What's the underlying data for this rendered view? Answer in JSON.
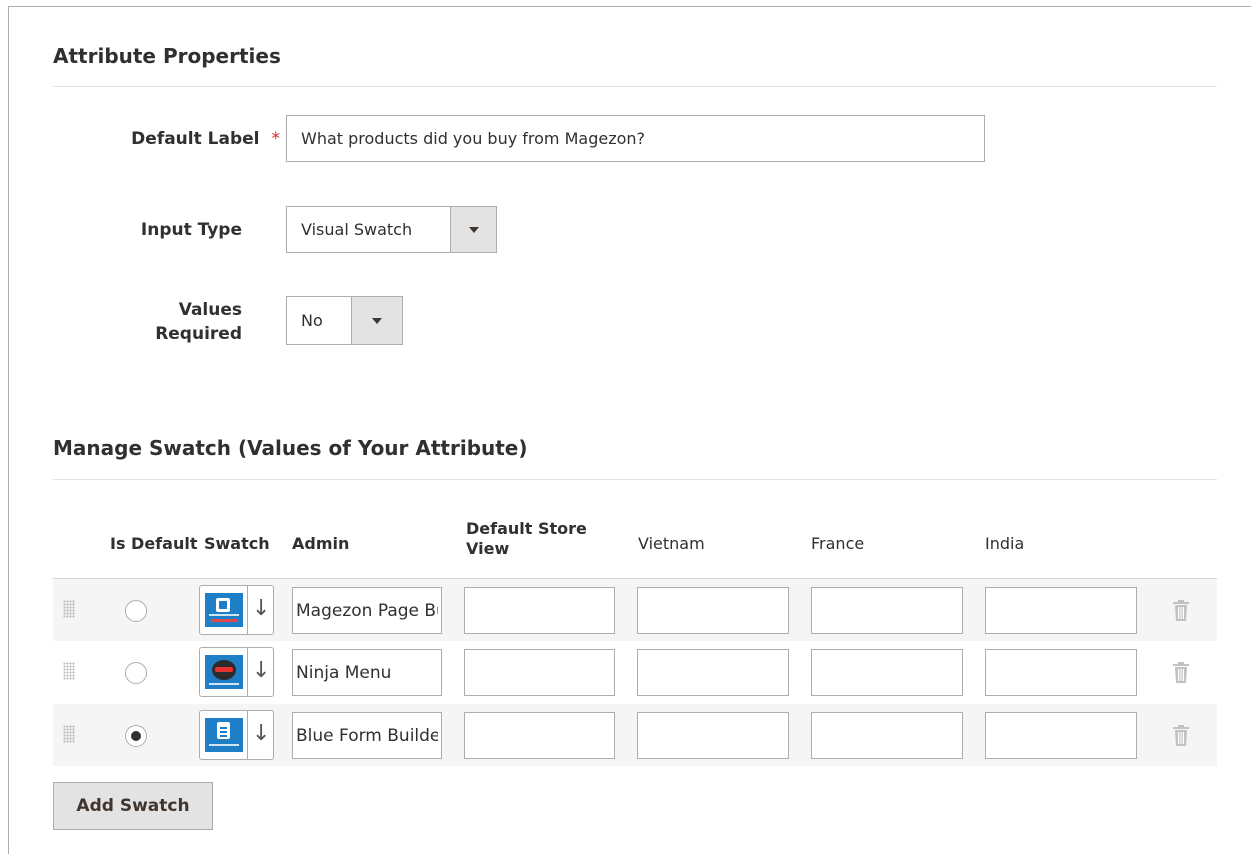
{
  "section_properties": {
    "title": "Attribute Properties",
    "default_label": {
      "label": "Default Label",
      "required_mark": "*",
      "value": "What products did you buy from Magezon?"
    },
    "input_type": {
      "label": "Input Type",
      "value": "Visual Swatch"
    },
    "values_required": {
      "label_line1": "Values",
      "label_line2": "Required",
      "value": "No"
    }
  },
  "section_swatch": {
    "title": "Manage Swatch (Values of Your Attribute)",
    "headers": {
      "is_default": "Is Default",
      "swatch": "Swatch",
      "admin": "Admin",
      "default_store_line1": "Default Store",
      "default_store_line2": "View",
      "vietnam": "Vietnam",
      "france": "France",
      "india": "India"
    },
    "rows": [
      {
        "admin": "Magezon Page Builder",
        "default_store": "",
        "vietnam": "",
        "france": "",
        "india": "",
        "is_default": false,
        "swatch_icon": "page-builder-logo"
      },
      {
        "admin": "Ninja Menu",
        "default_store": "",
        "vietnam": "",
        "france": "",
        "india": "",
        "is_default": false,
        "swatch_icon": "ninja-menu-logo"
      },
      {
        "admin": "Blue Form Builder",
        "default_store": "",
        "vietnam": "",
        "france": "",
        "india": "",
        "is_default": true,
        "swatch_icon": "blue-form-builder-logo"
      }
    ],
    "add_button": "Add Swatch"
  },
  "colors": {
    "required": "#e22626",
    "border": "#adadad",
    "button_bg": "#e3e3e3",
    "row_alt": "#f5f5f5",
    "thumb_blue": "#1f7fc6"
  }
}
